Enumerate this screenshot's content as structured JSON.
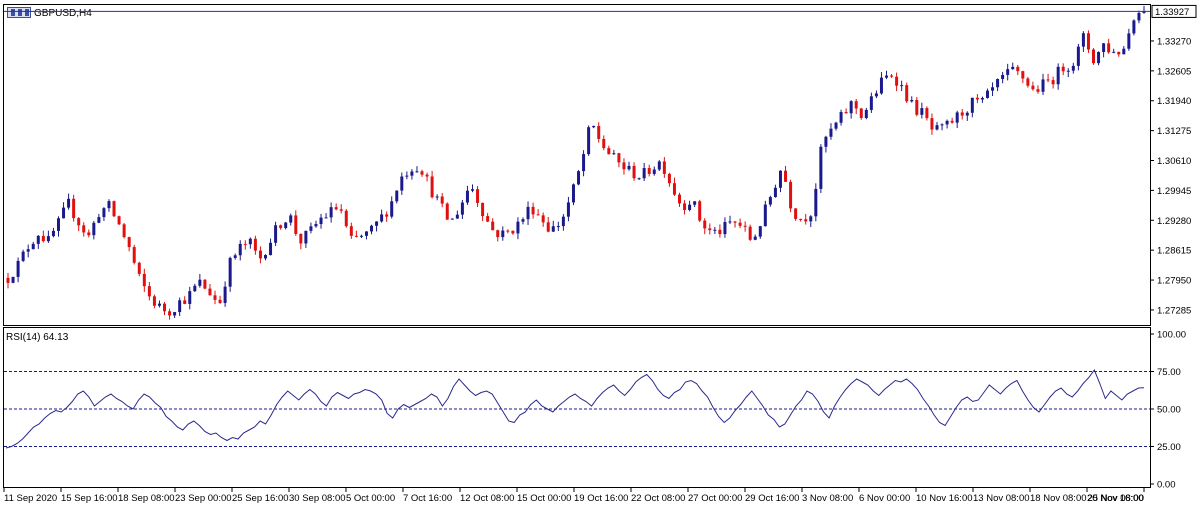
{
  "window": {
    "symbol_title": "GBPUSD,H4",
    "rsi_title": "RSI(14) 64.13"
  },
  "colors": {
    "bull": "#1a1a8c",
    "bear": "#e01010",
    "rsi_line": "#2a2a8c",
    "grid_dash": "#1a1a8c",
    "price_line": "#2a2ab8"
  },
  "chart_data": [
    {
      "type": "candlestick",
      "title": "GBPUSD,H4",
      "price_axis_ticks": [
        "1.33270",
        "1.32605",
        "1.31940",
        "1.31275",
        "1.30610",
        "1.29945",
        "1.29280",
        "1.28615",
        "1.27950",
        "1.27285"
      ],
      "price_axis_values": [
        1.3327,
        1.32605,
        1.3194,
        1.31275,
        1.3061,
        1.29945,
        1.2928,
        1.28615,
        1.2795,
        1.27285
      ],
      "ylim": [
        1.2695,
        1.3407
      ],
      "current_price_label": "1.33927",
      "current_price": 1.33927,
      "time_axis_ticks": [
        "11 Sep 2020",
        "15 Sep 16:00",
        "18 Sep 08:00",
        "23 Sep 00:00",
        "25 Sep 16:00",
        "30 Sep 08:00",
        "5 Oct 00:00",
        "7 Oct 16:00",
        "12 Oct 08:00",
        "15 Oct 00:00",
        "19 Oct 16:00",
        "22 Oct 08:00",
        "27 Oct 00:00",
        "29 Oct 16:00",
        "3 Nov 08:00",
        "6 Nov 00:00",
        "10 Nov 16:00",
        "13 Nov 08:00",
        "18 Nov 08:00",
        "20 Nov 16:00",
        "25 Nov 08:00"
      ],
      "close_path": [
        1.28,
        1.283,
        1.287,
        1.29,
        1.288,
        1.292,
        1.2965,
        1.2925,
        1.289,
        1.2945,
        1.296,
        1.292,
        1.287,
        1.28,
        1.276,
        1.2735,
        1.2725,
        1.2745,
        1.276,
        1.279,
        1.277,
        1.274,
        1.283,
        1.2865,
        1.288,
        1.284,
        1.288,
        1.292,
        1.294,
        1.288,
        1.29,
        1.293,
        1.2945,
        1.296,
        1.288,
        1.289,
        1.29,
        1.293,
        1.296,
        1.302,
        1.3045,
        1.305,
        1.3,
        1.296,
        1.292,
        1.296,
        1.301,
        1.296,
        1.291,
        1.2895,
        1.2905,
        1.2925,
        1.296,
        1.2935,
        1.2905,
        1.2925,
        1.298,
        1.305,
        1.3145,
        1.31,
        1.307,
        1.305,
        1.3035,
        1.3025,
        1.3045,
        1.306,
        1.3005,
        1.296,
        1.2975,
        1.292,
        1.29,
        1.2905,
        1.2925,
        1.2915,
        1.288,
        1.293,
        1.299,
        1.305,
        1.295,
        1.293,
        1.295,
        1.31,
        1.313,
        1.316,
        1.319,
        1.316,
        1.32,
        1.324,
        1.3255,
        1.322,
        1.318,
        1.3165,
        1.3125,
        1.313,
        1.315,
        1.317,
        1.319,
        1.319,
        1.322,
        1.3245,
        1.326,
        1.3245,
        1.3215,
        1.323,
        1.3245,
        1.327,
        1.328,
        1.3335,
        1.3285,
        1.332,
        1.33,
        1.331,
        1.3385,
        1.3393
      ],
      "rsi": {
        "title": "RSI(14) 64.13",
        "name": "RSI(14)",
        "last_value": 64.13,
        "ylim": [
          0,
          100
        ],
        "tick_labels": [
          "100.00",
          "75.00",
          "50.00",
          "25.00",
          "0.00"
        ],
        "tick_values": [
          100,
          75,
          50,
          25,
          0
        ],
        "levels": [
          75,
          50,
          25
        ],
        "values": [
          24,
          25,
          27,
          30,
          34,
          38,
          40,
          44,
          47,
          49,
          48,
          51,
          55,
          60,
          62,
          58,
          52,
          55,
          58,
          60,
          57,
          55,
          52,
          50,
          56,
          60,
          58,
          54,
          51,
          45,
          42,
          38,
          36,
          40,
          42,
          39,
          35,
          33,
          34,
          31,
          29,
          31,
          30,
          34,
          36,
          38,
          42,
          40,
          46,
          53,
          58,
          62,
          59,
          56,
          60,
          63,
          60,
          55,
          52,
          58,
          61,
          59,
          57,
          60,
          61,
          63,
          62,
          60,
          56,
          47,
          44,
          50,
          53,
          51,
          53,
          55,
          57,
          60,
          58,
          52,
          57,
          65,
          70,
          66,
          62,
          59,
          61,
          62,
          60,
          54,
          48,
          42,
          41,
          46,
          48,
          53,
          56,
          52,
          50,
          48,
          52,
          55,
          58,
          60,
          57,
          55,
          52,
          57,
          61,
          64,
          66,
          62,
          59,
          63,
          68,
          71,
          73,
          69,
          63,
          59,
          57,
          61,
          63,
          68,
          69,
          67,
          62,
          58,
          51,
          45,
          41,
          44,
          49,
          53,
          58,
          62,
          57,
          52,
          46,
          43,
          38,
          40,
          46,
          52,
          56,
          62,
          60,
          55,
          48,
          44,
          52,
          58,
          63,
          67,
          70,
          68,
          66,
          62,
          59,
          63,
          66,
          69,
          68,
          70,
          67,
          63,
          57,
          52,
          46,
          41,
          39,
          45,
          51,
          56,
          58,
          55,
          56,
          61,
          66,
          63,
          60,
          64,
          67,
          69,
          62,
          56,
          51,
          48,
          53,
          58,
          62,
          64,
          60,
          58,
          62,
          67,
          71,
          76,
          67,
          57,
          62,
          59,
          56,
          60,
          62,
          64,
          64.13
        ]
      }
    }
  ]
}
